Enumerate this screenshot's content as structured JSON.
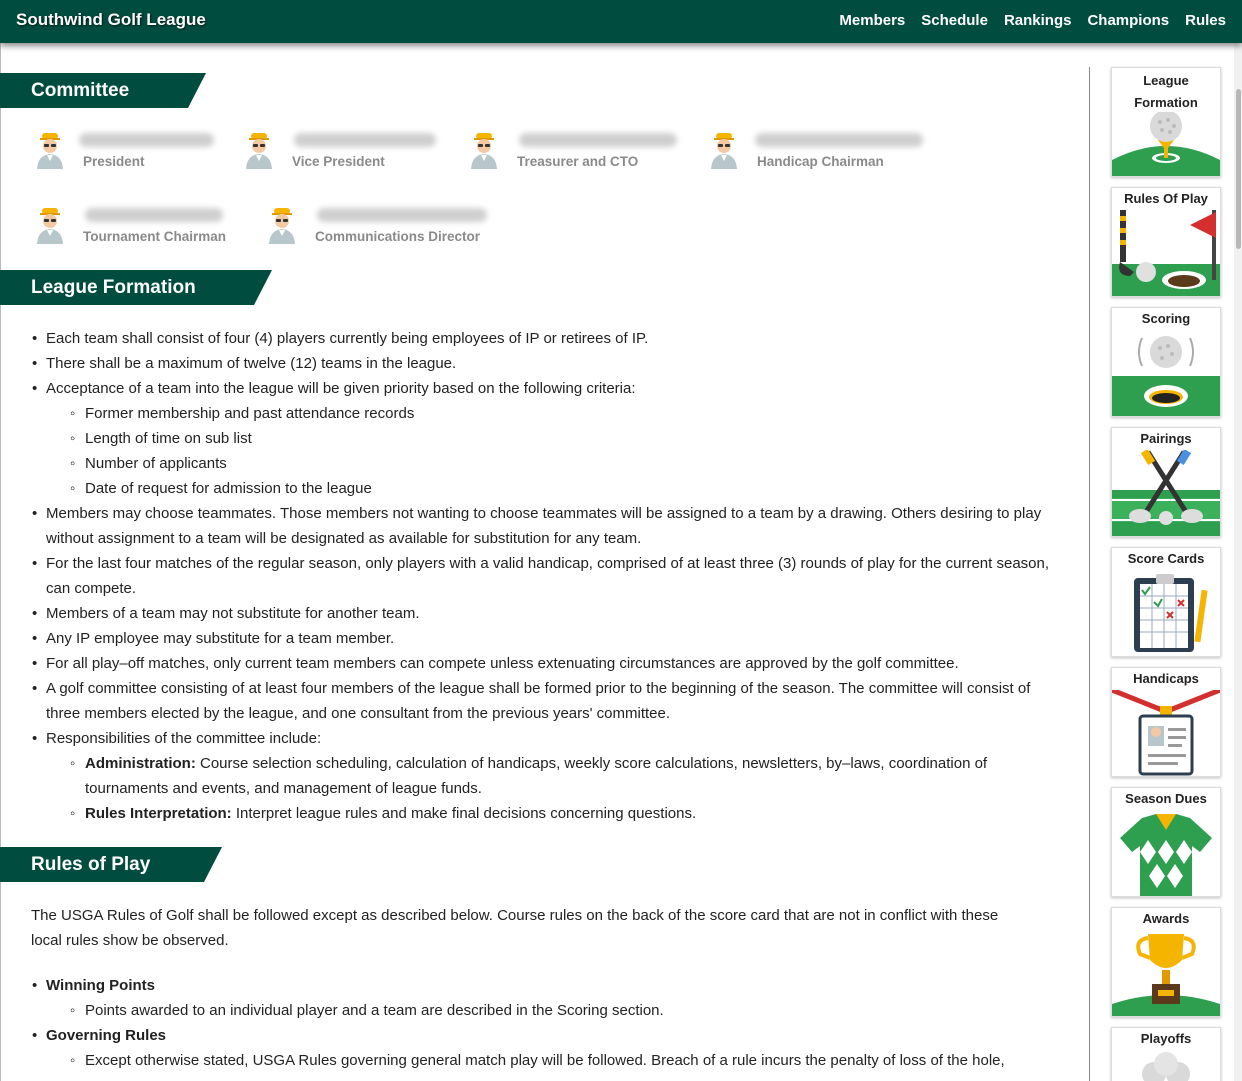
{
  "header": {
    "brand": "Southwind Golf League",
    "nav": [
      "Members",
      "Schedule",
      "Rankings",
      "Champions",
      "Rules"
    ]
  },
  "committee": {
    "title": "Committee",
    "members": [
      {
        "role": "President"
      },
      {
        "role": "Vice President"
      },
      {
        "role": "Treasurer and CTO"
      },
      {
        "role": "Handicap Chairman"
      },
      {
        "role": "Tournament Chairman"
      },
      {
        "role": "Communications Director"
      }
    ]
  },
  "league_formation": {
    "title": "League Formation",
    "items": [
      "Each team shall consist of four (4) players currently being employees of IP or retirees of IP.",
      "There shall be a maximum of twelve (12) teams in the league.",
      "Acceptance of a team into the league will be given priority based on the following criteria:",
      "Members may choose teammates. Those members not wanting to choose teammates will be assigned to a team by a drawing. Others desiring to play without assignment to a team will be designated as available for substitution for any team.",
      "For the last four matches of the regular season, only players with a valid handicap, comprised of at least three (3) rounds of play for the current season, can compete.",
      "Members of a team may not substitute for another team.",
      "Any IP employee may substitute for a team member.",
      "For all play–off matches, only current team members can compete unless extenuating circumstances are approved by the golf committee.",
      "A golf committee consisting of at least four members of the league shall be formed prior to the beginning of the season. The committee will consist of three members elected by the league, and one consultant from the previous years' committee.",
      "Responsibilities of the committee include:"
    ],
    "criteria": [
      "Former membership and past attendance records",
      "Length of time on sub list",
      "Number of applicants",
      "Date of request for admission to the league"
    ],
    "responsibilities": [
      {
        "term": "Administration:",
        "text": " Course selection scheduling, calculation of handicaps, weekly score calculations, newsletters, by–laws, coordination of tournaments and events, and management of league funds."
      },
      {
        "term": "Rules Interpretation:",
        "text": " Interpret league rules and make final decisions concerning questions."
      }
    ]
  },
  "rules_of_play": {
    "title": "Rules of Play",
    "intro": "The USGA Rules of Golf shall be followed except as described below. Course rules on the back of the score card that are not in conflict with these local rules show be observed.",
    "sections": [
      {
        "heading": "Winning Points",
        "text": "Points awarded to an individual player and a team are described in the Scoring section."
      },
      {
        "heading": "Governing Rules",
        "text": "Except otherwise stated, USGA Rules governing general match play will be followed. Breach of a rule incurs the penalty of loss of the hole,"
      }
    ]
  },
  "sidebar": {
    "cards": [
      {
        "label": "League Formation",
        "icon": "golf-ball-on-tee-icon"
      },
      {
        "label": "Rules Of Play",
        "icon": "flag-and-club-icon"
      },
      {
        "label": "Scoring",
        "icon": "ball-into-hole-icon"
      },
      {
        "label": "Pairings",
        "icon": "crossed-clubs-icon"
      },
      {
        "label": "Score Cards",
        "icon": "clipboard-scorecard-icon"
      },
      {
        "label": "Handicaps",
        "icon": "id-badge-icon"
      },
      {
        "label": "Season Dues",
        "icon": "argyle-shirt-icon"
      },
      {
        "label": "Awards",
        "icon": "trophy-icon"
      },
      {
        "label": "Playoffs",
        "icon": "golf-balls-icon"
      }
    ]
  },
  "colors": {
    "brand_green": "#004d40",
    "accent_green": "#2e9e4f"
  }
}
